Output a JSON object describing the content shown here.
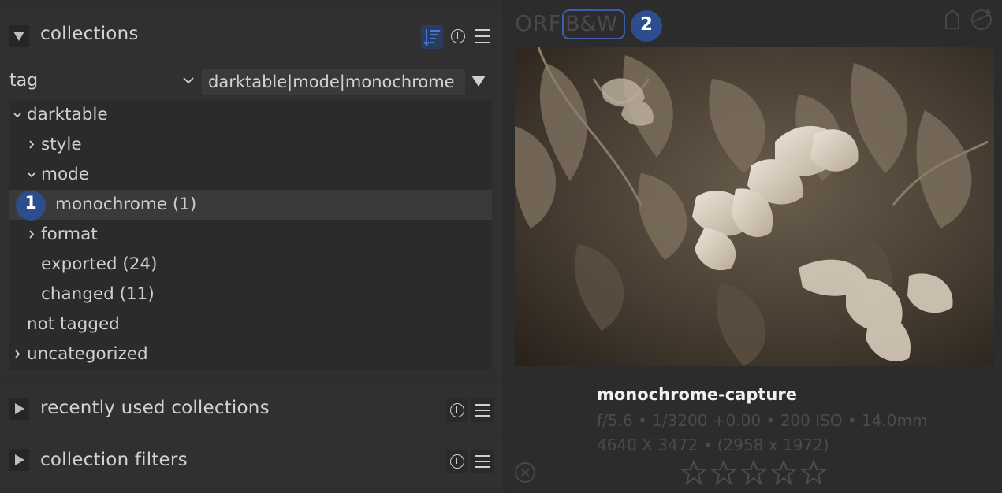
{
  "collections": {
    "title": "collections",
    "rule_property": "tag",
    "rule_value": "darktable|mode|monochrome",
    "tree": [
      {
        "label": "darktable",
        "expander": "expanded"
      },
      {
        "label": "style",
        "expander": "collapsed"
      },
      {
        "label": "mode",
        "expander": "expanded"
      },
      {
        "label": "monochrome (1)",
        "expander": "none",
        "selected": true
      },
      {
        "label": "format",
        "expander": "collapsed"
      },
      {
        "label": "exported (24)",
        "expander": "none"
      },
      {
        "label": "changed (11)",
        "expander": "none"
      },
      {
        "label": "not tagged",
        "expander": "none"
      },
      {
        "label": "uncategorized",
        "expander": "collapsed"
      }
    ],
    "icons": [
      "sort-icon",
      "info-icon",
      "presets-menu-icon"
    ]
  },
  "recent": {
    "title": "recently used collections"
  },
  "filters": {
    "title": "collection filters"
  },
  "callouts": {
    "one": "1",
    "two": "2"
  },
  "thumbnail": {
    "extension": "ORF",
    "group_label": "B&W",
    "filename": "monochrome-capture",
    "exif": "f/5.6 • 1/3200 +0.00 • 200 ISO • 14.0mm",
    "dimensions": "4640 X 3472 • (2958 x 1972)",
    "rating": 0,
    "max_rating": 5
  },
  "colors": {
    "accent": "#2d4e8e",
    "panel": "#303030",
    "background": "#2b2b2b"
  }
}
